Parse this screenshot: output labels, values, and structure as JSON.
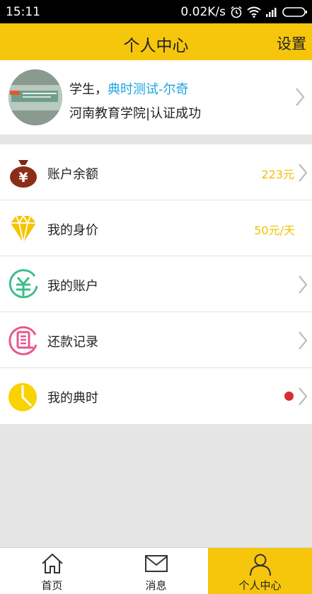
{
  "status_bar": {
    "time": "15:11",
    "network_speed": "0.02K/s",
    "icons": [
      "alarm-icon",
      "wifi-icon",
      "signal-icon",
      "battery-icon"
    ]
  },
  "header": {
    "title": "个人中心",
    "settings_label": "设置"
  },
  "profile": {
    "role": "学生，",
    "name": "典时测试-尔奇",
    "school_status": "河南教育学院|认证成功"
  },
  "menu": [
    {
      "label": "账户余额",
      "value": "223元",
      "icon": "money-bag-icon"
    },
    {
      "label": "我的身价",
      "value": "50元/天",
      "icon": "diamond-icon"
    },
    {
      "label": "我的账户",
      "value": "",
      "icon": "yuan-circle-icon"
    },
    {
      "label": "还款记录",
      "value": "",
      "icon": "record-icon"
    },
    {
      "label": "我的典时",
      "value": "",
      "icon": "clock-icon",
      "has_notification": true
    }
  ],
  "tabbar": {
    "tabs": [
      {
        "label": "首页",
        "icon": "home-icon"
      },
      {
        "label": "消息",
        "icon": "mail-icon"
      },
      {
        "label": "个人中心",
        "icon": "user-icon",
        "active": true
      }
    ]
  },
  "colors": {
    "brand_yellow": "#f6c60c",
    "highlight_blue": "#1ea5e0",
    "value_yellow": "#f2c000",
    "badge_red": "#d62f2f"
  }
}
